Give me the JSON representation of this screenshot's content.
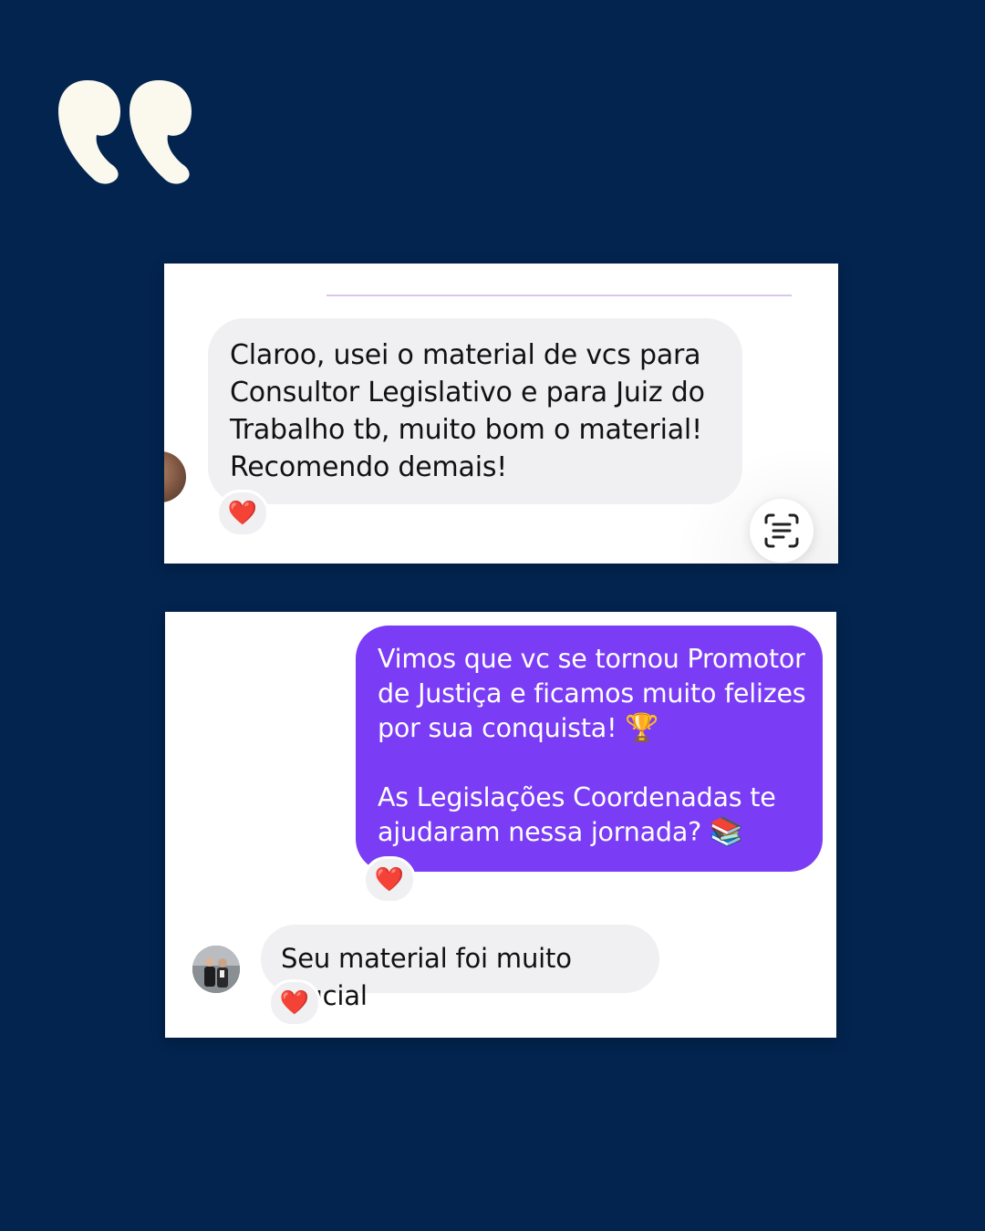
{
  "background_color": "#03244f",
  "decoration": {
    "icon": "opening-quotation-mark-icon"
  },
  "screenshot_1": {
    "message": "Claroo, usei o material de vcs para Consultor Legislativo e para Juiz do Trabalho tb, muito bom o material! Recomendo demais!",
    "reaction": "❤️",
    "scan_icon": "live-text-scan-icon"
  },
  "screenshot_2": {
    "sent_message": {
      "line1": "Vimos que vc se tornou Promotor de Justiça e ficamos muito felizes por sua conquista!",
      "line1_emoji": "🏆",
      "line2": "As Legislações Coordenadas te ajudaram nessa jornada?",
      "line2_emoji": "📚",
      "reaction": "❤️"
    },
    "reply": {
      "message": "Seu material foi muito crucial",
      "reaction": "❤️"
    }
  },
  "colors": {
    "sent_bubble": "#7a3df5",
    "received_bubble": "#f0f0f2",
    "heart": "#e0233a"
  }
}
